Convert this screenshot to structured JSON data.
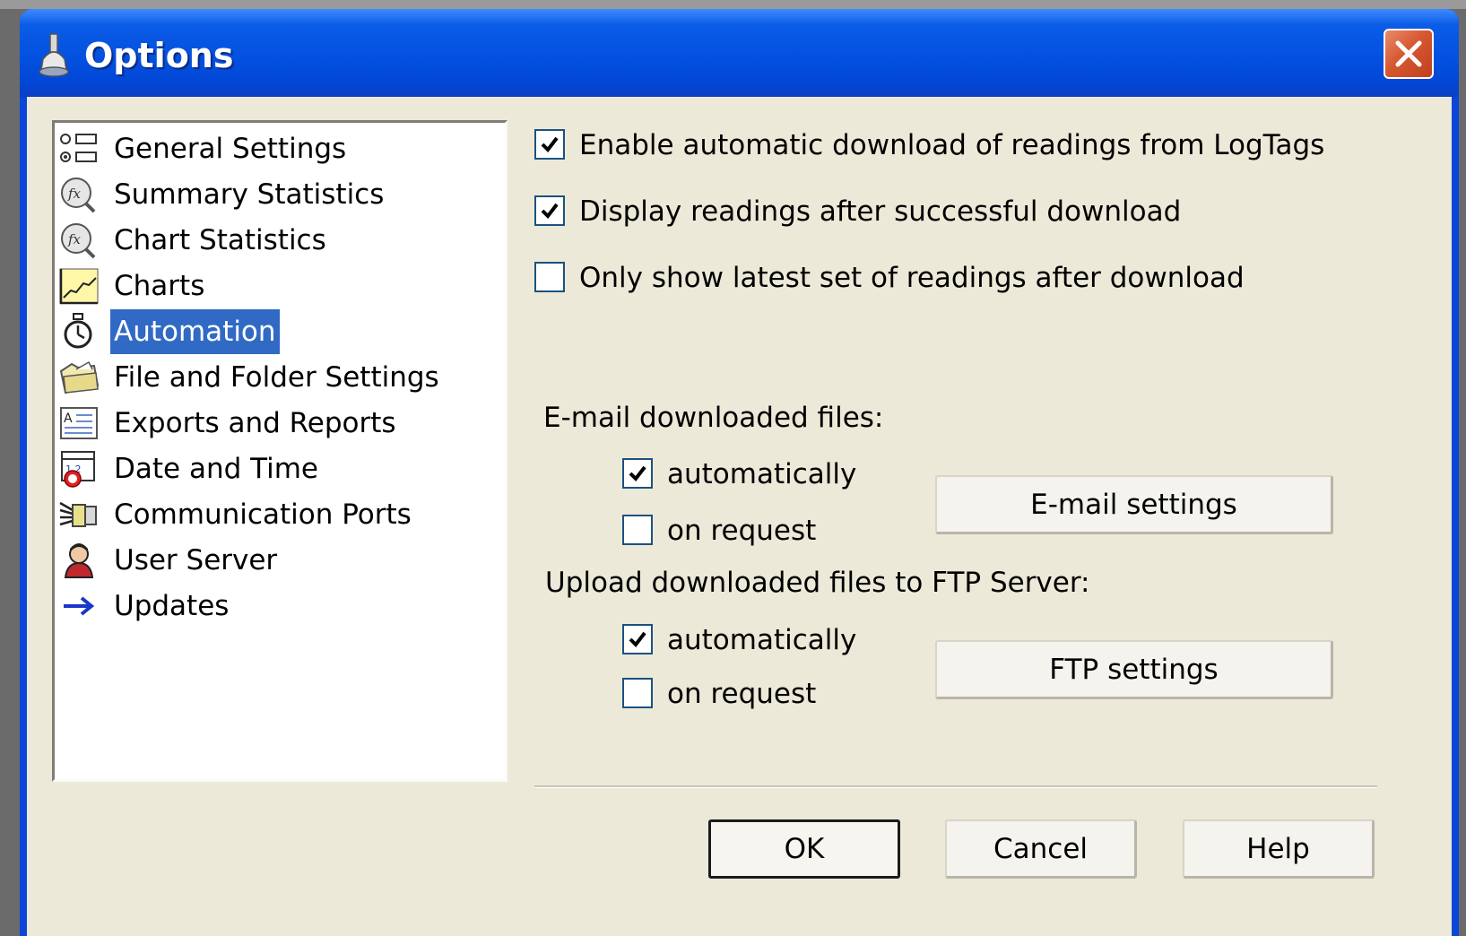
{
  "window": {
    "title": "Options",
    "icon": "app-bell-icon",
    "close_icon": "close-icon"
  },
  "nav": {
    "items": [
      {
        "label": "General Settings",
        "icon": "general-settings-icon"
      },
      {
        "label": "Summary Statistics",
        "icon": "fx-statistics-icon"
      },
      {
        "label": "Chart Statistics",
        "icon": "fx-statistics-icon"
      },
      {
        "label": "Charts",
        "icon": "chart-icon"
      },
      {
        "label": "Automation",
        "icon": "stopwatch-icon",
        "selected": true
      },
      {
        "label": "File and Folder Settings",
        "icon": "folder-icon"
      },
      {
        "label": "Exports and Reports",
        "icon": "report-icon"
      },
      {
        "label": "Date and Time",
        "icon": "calendar-clock-icon"
      },
      {
        "label": "Communication Ports",
        "icon": "port-icon"
      },
      {
        "label": "User Server",
        "icon": "user-icon"
      },
      {
        "label": "Updates",
        "icon": "arrow-right-icon"
      }
    ]
  },
  "options": {
    "enable_auto_download": {
      "label": "Enable automatic download of readings from LogTags",
      "checked": true
    },
    "display_after_download": {
      "label": "Display readings after successful download",
      "checked": true
    },
    "only_latest": {
      "label": "Only show latest set of readings after download",
      "checked": false
    }
  },
  "email": {
    "group_label": "E-mail downloaded files:",
    "automatically": {
      "label": "automatically",
      "checked": true
    },
    "on_request": {
      "label": "on request",
      "checked": false
    },
    "settings_button": "E-mail settings"
  },
  "ftp": {
    "group_label": "Upload downloaded files to FTP Server:",
    "automatically": {
      "label": "automatically",
      "checked": true
    },
    "on_request": {
      "label": "on request",
      "checked": false
    },
    "settings_button": "FTP settings"
  },
  "buttons": {
    "ok": "OK",
    "cancel": "Cancel",
    "help": "Help"
  },
  "colors": {
    "titlebar": "#0351e0",
    "selection": "#316ac5",
    "dialog_bg": "#ece9d8",
    "close": "#d65830"
  }
}
